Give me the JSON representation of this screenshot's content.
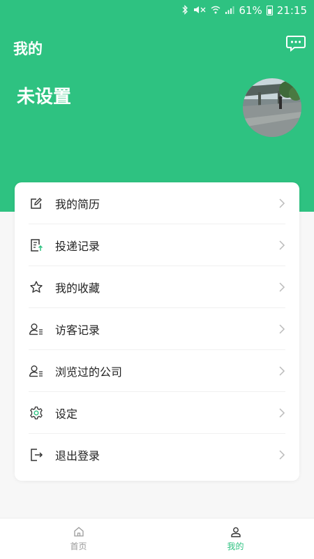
{
  "status_bar": {
    "battery_text": "61%",
    "time": "21:15",
    "icons": [
      "bluetooth-icon",
      "mute-icon",
      "wifi-icon",
      "signal-icon",
      "battery-icon"
    ]
  },
  "header": {
    "title": "我的",
    "username": "未设置",
    "message_icon": "chat-bubble-icon",
    "accent_color": "#2ec281"
  },
  "menu": {
    "items": [
      {
        "label": "我的简历",
        "icon": "edit-icon"
      },
      {
        "label": "投递记录",
        "icon": "document-upload-icon"
      },
      {
        "label": "我的收藏",
        "icon": "star-icon"
      },
      {
        "label": "访客记录",
        "icon": "user-list-icon"
      },
      {
        "label": "浏览过的公司",
        "icon": "user-list-icon"
      },
      {
        "label": "设定",
        "icon": "gear-icon"
      },
      {
        "label": "退出登录",
        "icon": "logout-icon"
      }
    ]
  },
  "tabbar": {
    "tabs": [
      {
        "label": "首页",
        "icon": "home-icon",
        "active": false
      },
      {
        "label": "我的",
        "icon": "person-icon",
        "active": true
      }
    ]
  }
}
